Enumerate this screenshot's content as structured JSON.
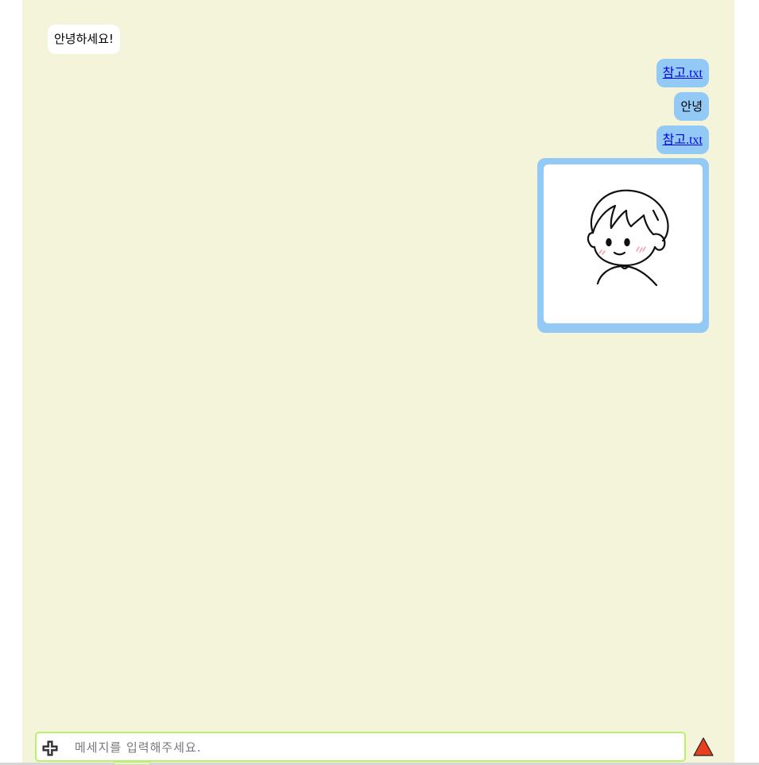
{
  "messages": [
    {
      "side": "left",
      "type": "text",
      "text": "안녕하세요!"
    },
    {
      "side": "right",
      "type": "file",
      "text": "참고.txt"
    },
    {
      "side": "right",
      "type": "text",
      "text": "안녕"
    },
    {
      "side": "right",
      "type": "file",
      "text": "참고.txt"
    },
    {
      "side": "right",
      "type": "image",
      "icon": "cartoon-boy-avatar"
    }
  ],
  "composer": {
    "placeholder": "메세지를 입력해주세요.",
    "value": "",
    "attach_icon": "plus-icon",
    "send_icon": "red-triangle-send-icon"
  },
  "colors": {
    "panel_bg": "#f3f4da",
    "incoming_bubble": "#ffffff",
    "outgoing_bubble": "#93c9f5",
    "input_border": "#b8f266",
    "send_button": "#e8401c"
  }
}
